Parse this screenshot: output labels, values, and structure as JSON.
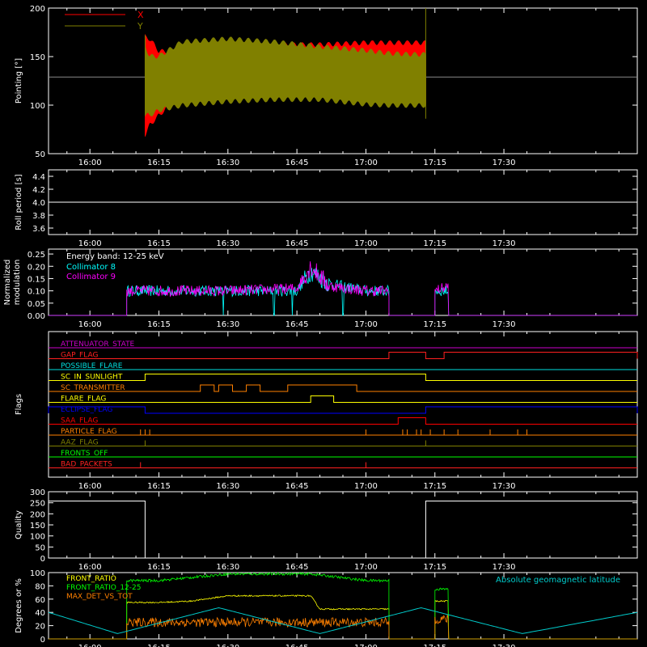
{
  "chart_data": [
    {
      "type": "line",
      "ylabel": "Pointing [°]",
      "ylim": [
        50,
        200
      ],
      "yticks": [
        50,
        100,
        150,
        200
      ],
      "xticks": [
        "16:00",
        "16:15",
        "16:30",
        "16:45",
        "17:00",
        "17:15",
        "17:30"
      ],
      "xlim_minutes": [
        -9,
        59
      ],
      "legend_position": "top-left",
      "reference_line": 129,
      "series": [
        {
          "name": "X",
          "color": "#ff0000",
          "x": [
            "16:12",
            "16:13",
            "16:15",
            "16:20",
            "16:30",
            "16:40",
            "16:50",
            "17:00",
            "17:05",
            "17:10",
            "17:13"
          ],
          "ymin": [
            70,
            80,
            90,
            112,
            120,
            118,
            115,
            110,
            108,
            106,
            104
          ],
          "ymax": [
            170,
            168,
            155,
            155,
            160,
            162,
            162,
            164,
            164,
            164,
            164
          ]
        },
        {
          "name": "Y",
          "color": "#808000",
          "x": [
            "16:12",
            "16:13",
            "16:15",
            "16:20",
            "16:30",
            "16:40",
            "16:50",
            "17:00",
            "17:05",
            "17:10",
            "17:13"
          ],
          "ymin": [
            90,
            90,
            95,
            100,
            104,
            106,
            106,
            101,
            100,
            100,
            100
          ],
          "ymax": [
            160,
            150,
            150,
            165,
            168,
            165,
            160,
            156,
            153,
            152,
            152
          ]
        }
      ]
    },
    {
      "type": "line",
      "ylabel": "Roll period [s]",
      "ylim": [
        3.5,
        4.5
      ],
      "yticks": [
        3.6,
        3.8,
        4.0,
        4.2,
        4.4
      ],
      "xticks": [
        "16:00",
        "16:15",
        "16:30",
        "16:45",
        "17:00",
        "17:15",
        "17:30"
      ],
      "series": [
        {
          "color": "#ffffff",
          "x": [
            "15:51",
            "17:59"
          ],
          "y": [
            4.0,
            4.0
          ]
        }
      ]
    },
    {
      "type": "line",
      "ylabel": "Normalized modulation",
      "ylim": [
        0,
        0.27
      ],
      "yticks": [
        0.0,
        0.05,
        0.1,
        0.15,
        0.2,
        0.25
      ],
      "xticks": [
        "16:00",
        "16:15",
        "16:30",
        "16:45",
        "17:00",
        "17:15",
        "17:30"
      ],
      "annotation": "Energy band: 12-25 keV",
      "legend_position": "top-left",
      "series": [
        {
          "name": "Collimator 8",
          "color": "#00ffff",
          "x": [
            "16:08",
            "16:30",
            "16:45",
            "16:48",
            "16:52",
            "17:00",
            "17:05",
            "17:15",
            "17:18"
          ],
          "y": [
            0.1,
            0.1,
            0.1,
            0.18,
            0.13,
            0.1,
            0.1,
            0.1,
            0.1
          ]
        },
        {
          "name": "Collimator 9",
          "color": "#ff00ff",
          "x": [
            "16:08",
            "16:30",
            "16:45",
            "16:48",
            "16:52",
            "17:00",
            "17:05",
            "17:15",
            "17:18"
          ],
          "y": [
            0.1,
            0.1,
            0.11,
            0.2,
            0.12,
            0.1,
            0.1,
            0.1,
            0.12
          ]
        }
      ]
    },
    {
      "type": "line",
      "ylabel": "Flags",
      "xticks": [
        "16:00",
        "16:15",
        "16:30",
        "16:45",
        "17:00",
        "17:15",
        "17:30"
      ],
      "flags": [
        {
          "name": "ATTENUATOR_STATE",
          "color": "#cc00cc",
          "on": []
        },
        {
          "name": "GAP_FLAG",
          "color": "#ff2020",
          "on": [
            [
              "17:05",
              "17:13"
            ],
            [
              "17:17",
              "17:59"
            ]
          ]
        },
        {
          "name": "POSSIBLE_FLARE",
          "color": "#00e0e0",
          "on": []
        },
        {
          "name": "SC_IN_SUNLIGHT",
          "color": "#ffff00",
          "on": [
            [
              "16:12",
              "17:13"
            ]
          ]
        },
        {
          "name": "SC_TRANSMITTER",
          "color": "#ff8000",
          "on": [
            [
              "16:24",
              "16:27"
            ],
            [
              "16:28",
              "16:31"
            ],
            [
              "16:34",
              "16:37"
            ],
            [
              "16:43",
              "16:58"
            ]
          ]
        },
        {
          "name": "FLARE_FLAG",
          "color": "#ffff00",
          "on": [
            [
              "16:48",
              "16:53"
            ]
          ]
        },
        {
          "name": "ECLIPSE_FLAG",
          "color": "#0000ff",
          "on": [
            [
              "15:51",
              "16:12"
            ],
            [
              "17:13",
              "17:59"
            ]
          ]
        },
        {
          "name": "SAA_FLAG",
          "color": "#ff0000",
          "on": [
            [
              "17:07",
              "17:13"
            ]
          ]
        },
        {
          "name": "PARTICLE_FLAG",
          "color": "#ff8000",
          "on": []
        },
        {
          "name": "AAZ_FLAG",
          "color": "#808000",
          "on": []
        },
        {
          "name": "FRONTS_OFF",
          "color": "#00ff00",
          "on": []
        },
        {
          "name": "BAD_PACKETS",
          "color": "#ff2020",
          "on": []
        }
      ]
    },
    {
      "type": "line",
      "ylabel": "Quality",
      "ylim": [
        0,
        300
      ],
      "yticks": [
        0,
        50,
        100,
        150,
        200,
        250,
        300
      ],
      "xticks": [
        "16:00",
        "16:15",
        "16:30",
        "16:45",
        "17:00",
        "17:15",
        "17:30"
      ],
      "series": [
        {
          "color": "#ffffff",
          "x": [
            "15:51",
            "16:12",
            "16:12",
            "17:13",
            "17:13",
            "17:59"
          ],
          "y": [
            258,
            258,
            0,
            0,
            258,
            258
          ]
        }
      ]
    },
    {
      "type": "line",
      "ylabel": "Degrees or %",
      "ylim": [
        0,
        100
      ],
      "yticks": [
        0,
        20,
        40,
        60,
        80,
        100
      ],
      "xticks": [
        "16:00",
        "16:15",
        "16:30",
        "16:45",
        "17:00",
        "17:15",
        "17:30"
      ],
      "legend_position": "top-left",
      "series": [
        {
          "name": "FRONT_RATIO",
          "color": "#ffff00",
          "x": [
            "16:08",
            "16:15",
            "16:22",
            "16:30",
            "16:40",
            "16:48",
            "16:50",
            "17:00",
            "17:05",
            "17:15",
            "17:18"
          ],
          "y": [
            55,
            55,
            57,
            65,
            65,
            65,
            45,
            45,
            45,
            57,
            57
          ]
        },
        {
          "name": "FRONT_RATIO_12-25",
          "color": "#00ff00",
          "x": [
            "16:08",
            "16:15",
            "16:30",
            "16:48",
            "17:00",
            "17:05",
            "17:15",
            "17:18"
          ],
          "y": [
            88,
            88,
            98,
            98,
            88,
            88,
            75,
            75
          ]
        },
        {
          "name": "MAX_DET_VS_TOT",
          "color": "#ff8000",
          "x": [
            "16:08",
            "16:15",
            "16:30",
            "16:45",
            "17:00",
            "17:05",
            "17:15",
            "17:18"
          ],
          "y": [
            25,
            25,
            25,
            25,
            25,
            25,
            30,
            30
          ]
        },
        {
          "name": "Absolute geomagnetic latitude",
          "color": "#00cccc",
          "x": [
            "15:51",
            "16:06",
            "16:28",
            "16:50",
            "17:12",
            "17:34",
            "17:59"
          ],
          "y": [
            40,
            8,
            47,
            8,
            47,
            8,
            40
          ]
        }
      ]
    }
  ]
}
